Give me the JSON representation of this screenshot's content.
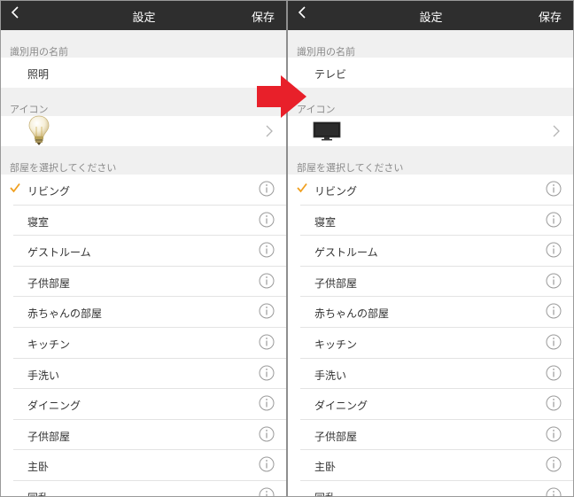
{
  "left": {
    "nav": {
      "title": "設定",
      "save_label": "保存"
    },
    "name_section_label": "識別用の名前",
    "name_value": "照明",
    "icon_section_label": "アイコン",
    "icon": "lightbulb-icon",
    "room_section_label": "部屋を選択してください",
    "rooms": [
      {
        "label": "リビング",
        "selected": true
      },
      {
        "label": "寝室",
        "selected": false
      },
      {
        "label": "ゲストルーム",
        "selected": false
      },
      {
        "label": "子供部屋",
        "selected": false
      },
      {
        "label": "赤ちゃんの部屋",
        "selected": false
      },
      {
        "label": "キッチン",
        "selected": false
      },
      {
        "label": "手洗い",
        "selected": false
      },
      {
        "label": "ダイニング",
        "selected": false
      },
      {
        "label": "子供部屋",
        "selected": false
      },
      {
        "label": "主卧",
        "selected": false
      },
      {
        "label": "同乱",
        "selected": false
      }
    ]
  },
  "right": {
    "nav": {
      "title": "設定",
      "save_label": "保存"
    },
    "name_section_label": "識別用の名前",
    "name_value": "テレビ",
    "icon_section_label": "アイコン",
    "icon": "tv-icon",
    "room_section_label": "部屋を選択してください",
    "rooms": [
      {
        "label": "リビング",
        "selected": true
      },
      {
        "label": "寝室",
        "selected": false
      },
      {
        "label": "ゲストルーム",
        "selected": false
      },
      {
        "label": "子供部屋",
        "selected": false
      },
      {
        "label": "赤ちゃんの部屋",
        "selected": false
      },
      {
        "label": "キッチン",
        "selected": false
      },
      {
        "label": "手洗い",
        "selected": false
      },
      {
        "label": "ダイニング",
        "selected": false
      },
      {
        "label": "子供部屋",
        "selected": false
      },
      {
        "label": "主卧",
        "selected": false
      },
      {
        "label": "同乱",
        "selected": false
      }
    ]
  },
  "colors": {
    "navbar": "#2e2e2e",
    "check": "#f0a020",
    "arrow": "#e8202a",
    "info": "#9a9a9a"
  }
}
